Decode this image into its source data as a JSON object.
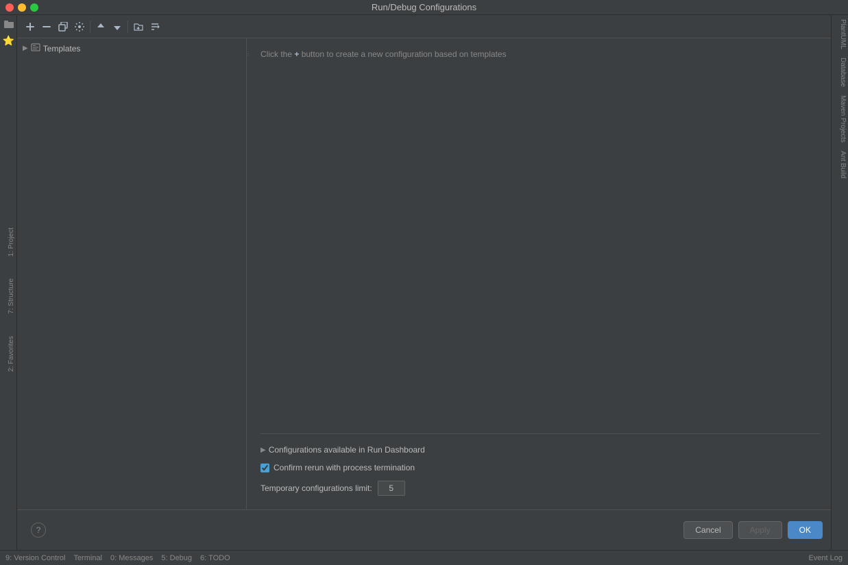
{
  "window": {
    "title": "Run/Debug Configurations"
  },
  "toolbar": {
    "add_label": "+",
    "remove_label": "−",
    "copy_label": "⧉",
    "wrench_label": "🔧",
    "move_up_label": "↑",
    "move_down_label": "↓",
    "folder_label": "📁",
    "sort_label": "⇅"
  },
  "tree": {
    "templates_label": "Templates",
    "templates_arrow": "▶"
  },
  "config_panel": {
    "hint_text_prefix": "Click the ",
    "hint_text_plus": "+",
    "hint_text_suffix": " button to create a new configuration based on templates"
  },
  "bottom_options": {
    "collapsible_label": "Configurations available in Run Dashboard",
    "checkbox_label": "Confirm rerun with process termination",
    "checkbox_checked": true,
    "limit_label": "Temporary configurations limit:",
    "limit_value": "5"
  },
  "buttons": {
    "cancel_label": "Cancel",
    "apply_label": "Apply",
    "ok_label": "OK",
    "help_label": "?"
  },
  "status_bar": {
    "version_control": "9: Version Control",
    "terminal": "Terminal",
    "messages": "0: Messages",
    "debug": "5: Debug",
    "todo": "6: TODO",
    "event_log": "Event Log"
  },
  "right_panels": {
    "plantuml": "PlantUML",
    "database": "Database",
    "maven": "Maven Projects",
    "ant_build": "Ant Build"
  }
}
